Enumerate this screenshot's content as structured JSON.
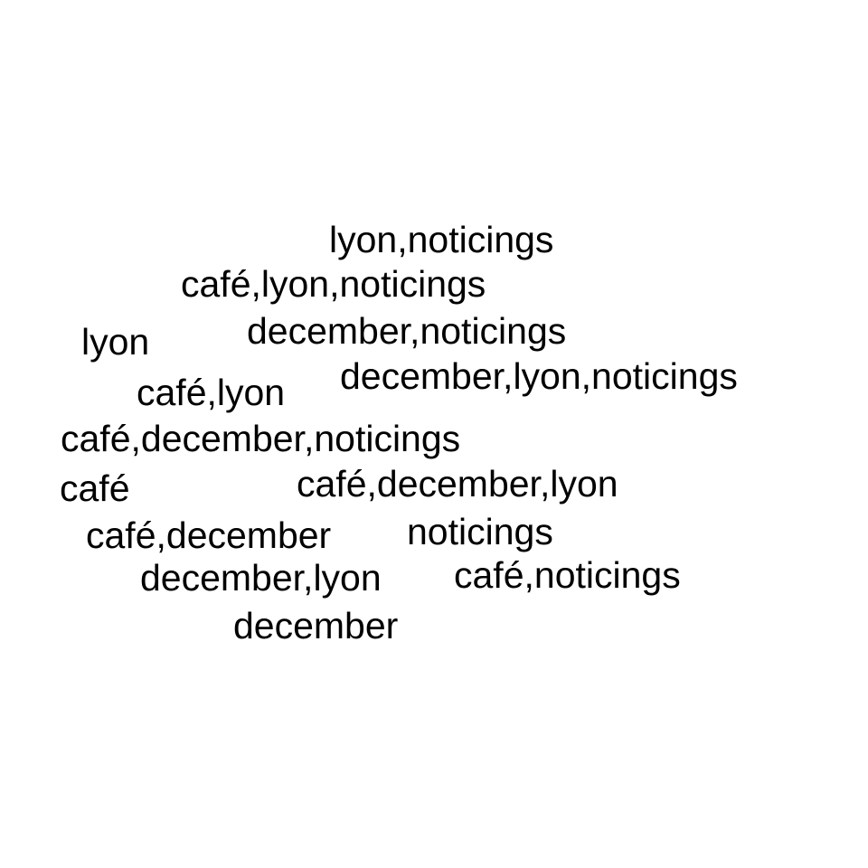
{
  "words": [
    "lyon,noticings",
    "café,lyon,noticings",
    "lyon",
    "december,noticings",
    "café,lyon",
    "december,lyon,noticings",
    "café,december,noticings",
    "café",
    "café,december,lyon",
    "café,december",
    "noticings",
    "december,lyon",
    "café,noticings",
    "december"
  ]
}
